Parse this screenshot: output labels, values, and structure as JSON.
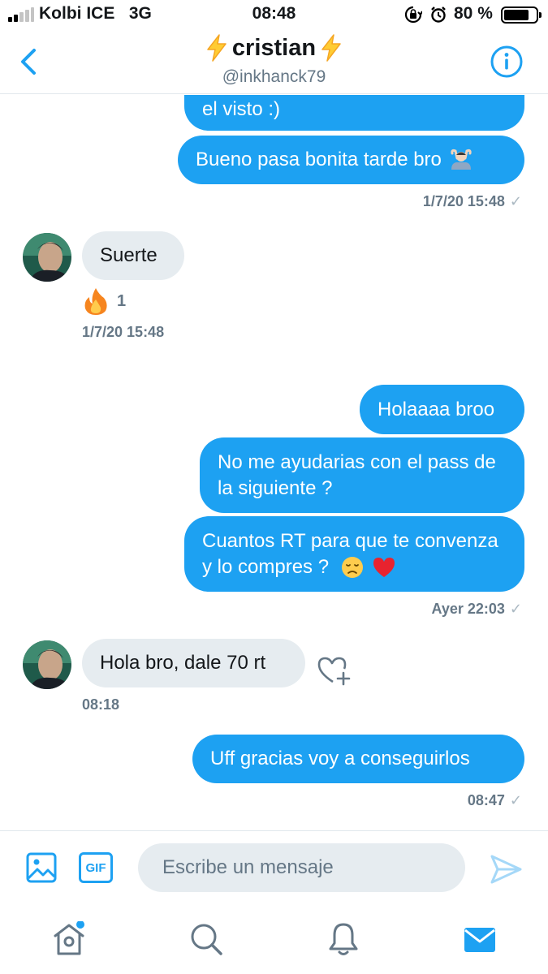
{
  "status_bar": {
    "carrier": "Kolbi ICE",
    "network": "3G",
    "time": "08:48",
    "battery_percent": "80 %",
    "battery_level": 0.8,
    "icons": [
      "signal-bars-icon",
      "orientation-lock-icon",
      "alarm-icon",
      "battery-icon"
    ]
  },
  "header": {
    "name": "cristian",
    "handle": "@inkhanck79",
    "icons": [
      "back-chevron-icon",
      "lightning-bolt-icon",
      "info-icon"
    ]
  },
  "messages": [
    {
      "direction": "sent",
      "text": "el visto :)"
    },
    {
      "direction": "sent",
      "text": "Bueno pasa bonita tarde bro",
      "emoji": "person-gesturing-ok-icon"
    },
    {
      "type": "timestamp",
      "text": "1/7/20 15:48",
      "read_icon": "✓"
    },
    {
      "direction": "received",
      "text": "Suerte",
      "reaction": {
        "emoji": "fire-icon",
        "count": "1"
      },
      "timestamp": "1/7/20 15:48"
    },
    {
      "direction": "sent",
      "text": "Holaaaa broo"
    },
    {
      "direction": "sent",
      "text": "No me ayudarias con el pass de la siguiente ?"
    },
    {
      "direction": "sent",
      "text": "Cuantos RT para que te convenza y lo compres ?",
      "emoji": [
        "disappointed-face-icon",
        "red-heart-icon"
      ]
    },
    {
      "type": "timestamp",
      "text": "Ayer 22:03",
      "read_icon": "✓"
    },
    {
      "direction": "received",
      "text": "Hola bro, dale 70 rt",
      "timestamp": "08:18"
    },
    {
      "direction": "sent",
      "text": "Uff gracias voy a conseguirlos"
    },
    {
      "type": "timestamp",
      "text": "08:47",
      "read_icon": "✓"
    }
  ],
  "composer": {
    "gif_label": "GIF",
    "placeholder": "Escribe un mensaje",
    "value": "",
    "icons": [
      "image-icon",
      "gif-icon",
      "send-icon"
    ]
  },
  "tab_bar": {
    "items": [
      "home-icon",
      "search-icon",
      "notifications-bell-icon",
      "messages-mail-icon"
    ],
    "active": "messages-mail-icon",
    "home_has_notification_dot": true
  },
  "colors": {
    "accent": "#1da1f2",
    "received_bubble": "#e6ecf0",
    "secondary_text": "#657786",
    "divider": "#e1e8ed"
  }
}
